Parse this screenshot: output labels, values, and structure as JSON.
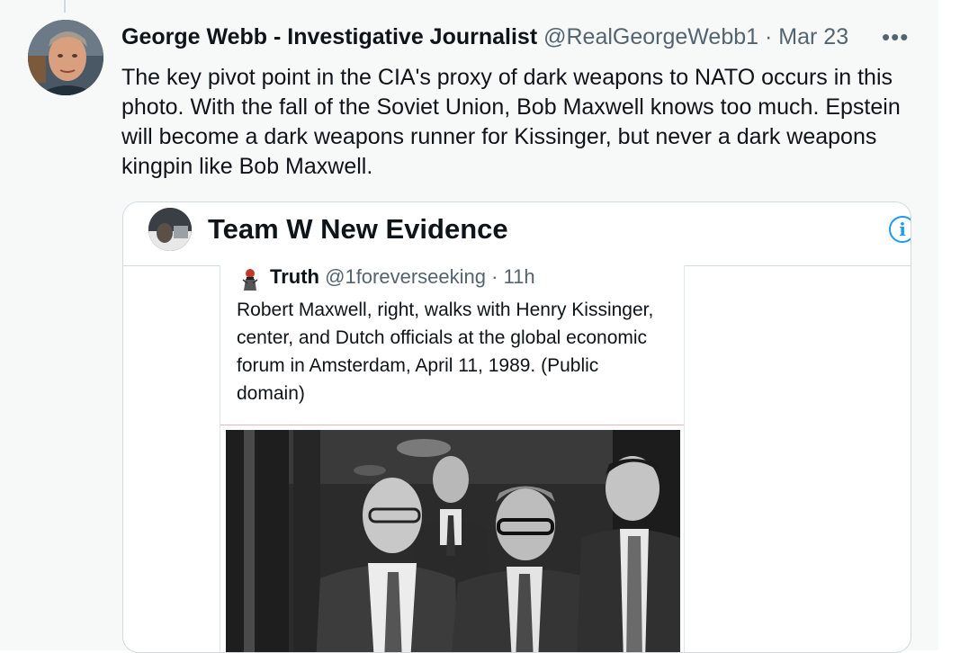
{
  "tweet": {
    "author_name": "George Webb - Investigative Journalist",
    "handle": "@RealGeorgeWebb1",
    "separator": "·",
    "date": "Mar 23",
    "more_icon": "more-horizontal-icon",
    "more_label": "•••",
    "text": "The key pivot point in the CIA's proxy of dark weapons to NATO occurs in this photo.  With the fall of the Soviet Union, Bob Maxwell knows too much.  Epstein will become a dark weapons runner for Kissinger, but never a dark weapons kingpin like Bob Maxwell."
  },
  "card": {
    "title": "Team W New Evidence",
    "info_icon": "info-icon",
    "info_glyph": "i",
    "embedded": {
      "name": "Truth",
      "handle": "@1foreverseeking",
      "separator": "·",
      "time": "11h",
      "text": "Robert Maxwell, right, walks with Henry Kissinger, center, and Dutch officials at the global economic forum in Amsterdam, April 11, 1989. (Public domain)"
    }
  },
  "colors": {
    "panel_bg": "#f7f9f9",
    "border": "#cfd9de",
    "secondary_text": "#536471",
    "accent": "#1d9bf0"
  }
}
